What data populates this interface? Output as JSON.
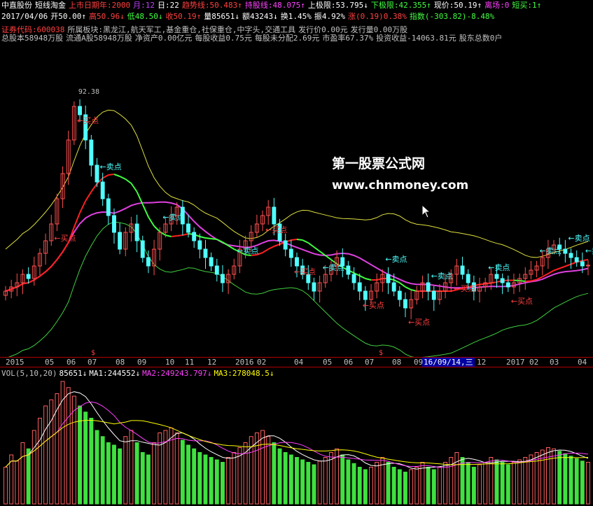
{
  "header": {
    "row1": [
      {
        "t": "中直股份",
        "c": "#ffffff"
      },
      {
        "t": "短线淘金",
        "c": "#ffffff"
      },
      {
        "t": "上市日期年:2000",
        "c": "#ff4040"
      },
      {
        "t": "月:12",
        "c": "#c040ff"
      },
      {
        "t": "日:22",
        "c": "#ffffff"
      },
      {
        "t": "趋势线:50.483↑",
        "c": "#ff4040"
      },
      {
        "t": "持股线:48.075↑",
        "c": "#ff40ff"
      },
      {
        "t": "上极限:53.795↓",
        "c": "#ffffff"
      },
      {
        "t": "下极限:42.355↑",
        "c": "#40ff40"
      },
      {
        "t": "现价:50.19↑",
        "c": "#ffffff"
      },
      {
        "t": "离场:0",
        "c": "#ff40ff"
      },
      {
        "t": "短买:1↑",
        "c": "#40ff40"
      }
    ],
    "row2": [
      {
        "t": "2017/04/06",
        "c": "#ffffff"
      },
      {
        "t": "开50.00↑",
        "c": "#ffffff"
      },
      {
        "t": "高50.96↓",
        "c": "#ff4040"
      },
      {
        "t": "低48.50↓",
        "c": "#40ff40"
      },
      {
        "t": "收50.19↑",
        "c": "#ff4040"
      },
      {
        "t": "量85651↓",
        "c": "#ffffff"
      },
      {
        "t": "额43243↓",
        "c": "#ffffff"
      },
      {
        "t": "换1.45%",
        "c": "#ffffff"
      },
      {
        "t": "振4.92%",
        "c": "#ffffff"
      },
      {
        "t": "涨(0.19)0.38%",
        "c": "#ff4040"
      },
      {
        "t": "指数(-303.82)-8.48%",
        "c": "#40ff40"
      }
    ],
    "row3": [
      {
        "t": "证券代码:600038",
        "c": "#ff4040"
      },
      {
        "t": "所属板块:黑龙江,航天军工,基金重仓,社保重仓,中字头,交通工具",
        "c": "#c0c0c0"
      },
      {
        "t": "发行价0.00元",
        "c": "#c0c0c0"
      },
      {
        "t": "发行量0.00万股",
        "c": "#c0c0c0"
      }
    ],
    "row4": [
      {
        "t": "总股本58948万股",
        "c": "#c0c0c0"
      },
      {
        "t": "流通A股58948万股",
        "c": "#c0c0c0"
      },
      {
        "t": "净资产0.00亿元",
        "c": "#c0c0c0"
      },
      {
        "t": "每股收益0.75元",
        "c": "#c0c0c0"
      },
      {
        "t": "每股未分配2.69元",
        "c": "#c0c0c0"
      },
      {
        "t": "市盈率67.37%",
        "c": "#c0c0c0"
      },
      {
        "t": "投资收益-14063.81元",
        "c": "#c0c0c0"
      },
      {
        "t": "股东总数0户",
        "c": "#c0c0c0"
      }
    ]
  },
  "price_labels": {
    "high_value": "92.38",
    "buy": "买点",
    "sell": "卖点"
  },
  "watermark": {
    "line1": "第一股票公式网",
    "line2": "www.chnmoney.com"
  },
  "axis": {
    "months": [
      {
        "t": "2015",
        "x": 8
      },
      {
        "t": "05",
        "x": 64
      },
      {
        "t": "06",
        "x": 95
      },
      {
        "t": "07",
        "x": 125
      },
      {
        "t": "08",
        "x": 165
      },
      {
        "t": "09",
        "x": 196
      },
      {
        "t": "10",
        "x": 236
      },
      {
        "t": "11",
        "x": 264
      },
      {
        "t": "12",
        "x": 296
      },
      {
        "t": "2016",
        "x": 336
      },
      {
        "t": "02",
        "x": 367
      },
      {
        "t": "04",
        "x": 420
      },
      {
        "t": "05",
        "x": 461
      },
      {
        "t": "06",
        "x": 491
      },
      {
        "t": "07",
        "x": 521
      },
      {
        "t": "08",
        "x": 560
      },
      {
        "t": "09",
        "x": 591
      },
      {
        "t": "12",
        "x": 681
      },
      {
        "t": "2017",
        "x": 723
      },
      {
        "t": "02",
        "x": 756
      },
      {
        "t": "03",
        "x": 785
      },
      {
        "t": "04",
        "x": 825
      }
    ],
    "highlight": "16/09/14,三",
    "markers": [
      "$",
      "$"
    ]
  },
  "volume": {
    "title": "VOL(5,10,20)",
    "value": "85651↓",
    "ma1": "MA1:244552↓",
    "ma2": "MA2:249243.797↓",
    "ma3": "MA3:278048.5↓"
  },
  "colors": {
    "up": "#ff5050",
    "down": "#50ffff",
    "upper_band": "#e0e040",
    "lower_band": "#40d040",
    "trend_red": "#ff2020",
    "trend_green": "#40ff40",
    "hold_line": "#e040e0",
    "vol_up": "#ff6060",
    "vol_down": "#40e040",
    "ma1": "#ffffff",
    "ma2": "#ff40ff",
    "ma3": "#ffff00"
  },
  "chart_data": {
    "type": "candlestick",
    "ylim": [
      30,
      100
    ],
    "closes": [
      44,
      45,
      46,
      48,
      47,
      50,
      53,
      56,
      60,
      66,
      72,
      80,
      88,
      86,
      80,
      74,
      70,
      66,
      62,
      58,
      54,
      58,
      60,
      56,
      52,
      50,
      54,
      58,
      60,
      62,
      64,
      60,
      58,
      56,
      54,
      52,
      50,
      48,
      46,
      48,
      50,
      54,
      56,
      58,
      60,
      62,
      64,
      60,
      56,
      54,
      52,
      50,
      48,
      46,
      44,
      46,
      48,
      50,
      52,
      50,
      48,
      46,
      44,
      42,
      44,
      46,
      48,
      46,
      44,
      42,
      40,
      42,
      44,
      46,
      44,
      42,
      44,
      46,
      48,
      50,
      48,
      46,
      44,
      45,
      46,
      48,
      47,
      46,
      45,
      46,
      47,
      48,
      49,
      50,
      52,
      54,
      55,
      54,
      53,
      52,
      51,
      50,
      50.19
    ],
    "volumes": [
      30,
      40,
      35,
      50,
      45,
      60,
      70,
      80,
      85,
      90,
      100,
      95,
      88,
      80,
      75,
      70,
      60,
      55,
      50,
      48,
      45,
      55,
      60,
      50,
      42,
      40,
      50,
      58,
      60,
      62,
      58,
      52,
      48,
      45,
      42,
      40,
      38,
      36,
      34,
      38,
      42,
      46,
      50,
      55,
      58,
      60,
      55,
      50,
      45,
      42,
      40,
      38,
      36,
      34,
      32,
      35,
      38,
      42,
      45,
      40,
      36,
      33,
      30,
      28,
      30,
      34,
      38,
      34,
      30,
      28,
      26,
      28,
      30,
      34,
      30,
      28,
      30,
      34,
      38,
      42,
      38,
      34,
      30,
      32,
      34,
      38,
      36,
      34,
      32,
      34,
      36,
      38,
      40,
      42,
      44,
      46,
      45,
      43,
      41,
      39,
      37,
      35,
      34
    ],
    "buy_signals": [
      8,
      12,
      45,
      50,
      62,
      70,
      78,
      88
    ],
    "sell_signals": [
      16,
      27,
      40,
      55,
      66,
      74,
      84,
      93,
      98,
      101
    ]
  }
}
